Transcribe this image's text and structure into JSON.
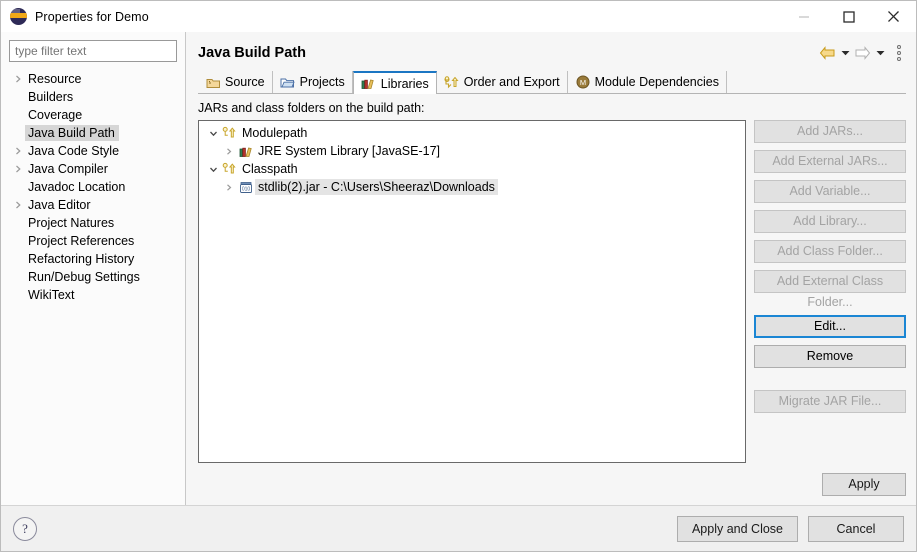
{
  "window": {
    "title": "Properties for Demo",
    "icon": "eclipse-icon",
    "controls": {
      "minimize": "minimize-icon",
      "maximize": "maximize-icon",
      "close": "close-icon"
    }
  },
  "sidebar": {
    "filter": {
      "placeholder": "type filter text",
      "value": ""
    },
    "items": [
      {
        "label": "Resource",
        "expandable": true,
        "selected": false
      },
      {
        "label": "Builders",
        "expandable": false,
        "selected": false
      },
      {
        "label": "Coverage",
        "expandable": false,
        "selected": false
      },
      {
        "label": "Java Build Path",
        "expandable": false,
        "selected": true
      },
      {
        "label": "Java Code Style",
        "expandable": true,
        "selected": false
      },
      {
        "label": "Java Compiler",
        "expandable": true,
        "selected": false
      },
      {
        "label": "Javadoc Location",
        "expandable": false,
        "selected": false
      },
      {
        "label": "Java Editor",
        "expandable": true,
        "selected": false
      },
      {
        "label": "Project Natures",
        "expandable": false,
        "selected": false
      },
      {
        "label": "Project References",
        "expandable": false,
        "selected": false
      },
      {
        "label": "Refactoring History",
        "expandable": false,
        "selected": false
      },
      {
        "label": "Run/Debug Settings",
        "expandable": false,
        "selected": false
      },
      {
        "label": "WikiText",
        "expandable": false,
        "selected": false
      }
    ]
  },
  "page": {
    "title": "Java Build Path",
    "nav": {
      "back": "back-arrow-icon",
      "back_menu": "chevron-down-icon",
      "forward": "forward-arrow-icon",
      "forward_menu": "chevron-down-icon",
      "view_menu": "vertical-dots-icon"
    }
  },
  "tabs": [
    {
      "label": "Source",
      "icon": "source-folder-icon",
      "active": false
    },
    {
      "label": "Projects",
      "icon": "projects-folder-icon",
      "active": false
    },
    {
      "label": "Libraries",
      "icon": "libraries-books-icon",
      "active": true
    },
    {
      "label": "Order and Export",
      "icon": "order-export-icon",
      "active": false
    },
    {
      "label": "Module Dependencies",
      "icon": "module-circle-icon",
      "active": false
    }
  ],
  "main": {
    "section_label": "JARs and class folders on the build path:",
    "tree": [
      {
        "label": "Modulepath",
        "icon": "modulepath-icon",
        "level": 1,
        "expanded": true,
        "selected": false
      },
      {
        "label": "JRE System Library [JavaSE-17]",
        "icon": "libraries-books-icon",
        "level": 2,
        "expanded": false,
        "selected": false
      },
      {
        "label": "Classpath",
        "icon": "classpath-icon",
        "level": 1,
        "expanded": true,
        "selected": false
      },
      {
        "label": "stdlib(2).jar - C:\\Users\\Sheeraz\\Downloads",
        "icon": "jar-icon",
        "level": 2,
        "expanded": false,
        "selected": true
      }
    ],
    "buttons": [
      {
        "label": "Add JARs...",
        "enabled": false,
        "focused": false
      },
      {
        "label": "Add External JARs...",
        "enabled": false,
        "focused": false
      },
      {
        "label": "Add Variable...",
        "enabled": false,
        "focused": false
      },
      {
        "label": "Add Library...",
        "enabled": false,
        "focused": false
      },
      {
        "label": "Add Class Folder...",
        "enabled": false,
        "focused": false
      },
      {
        "label": "Add External Class Folder...",
        "enabled": false,
        "focused": false
      },
      {
        "label": "Edit...",
        "enabled": true,
        "focused": true
      },
      {
        "label": "Remove",
        "enabled": true,
        "focused": false
      },
      {
        "label": "Migrate JAR File...",
        "enabled": false,
        "focused": false
      }
    ],
    "apply_label": "Apply"
  },
  "footer": {
    "help": "help-icon",
    "apply_and_close": "Apply and Close",
    "cancel": "Cancel"
  },
  "colors": {
    "accent": "#1b76c3",
    "focus": "#1b86d4",
    "selection": "#d6d6d6",
    "panel": "#f6f6f6"
  }
}
